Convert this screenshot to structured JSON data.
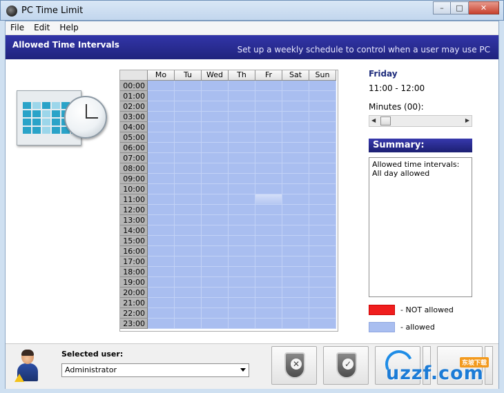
{
  "window": {
    "title": "PC Time Limit"
  },
  "menu": [
    "File",
    "Edit",
    "Help"
  ],
  "banner": {
    "title": "Allowed Time Intervals",
    "subtitle": "Set up a weekly schedule to control when a user may use PC"
  },
  "schedule": {
    "days": [
      "Mo",
      "Tu",
      "Wed",
      "Th",
      "Fr",
      "Sat",
      "Sun"
    ],
    "hours": [
      "00:00",
      "01:00",
      "02:00",
      "03:00",
      "04:00",
      "05:00",
      "06:00",
      "07:00",
      "08:00",
      "09:00",
      "10:00",
      "11:00",
      "12:00",
      "13:00",
      "14:00",
      "15:00",
      "16:00",
      "17:00",
      "18:00",
      "19:00",
      "20:00",
      "21:00",
      "22:00",
      "23:00"
    ],
    "selected_day": "Fr",
    "selected_hour": "11:00",
    "all_allowed": true
  },
  "details": {
    "day": "Friday",
    "time_range": "11:00 - 12:00",
    "minutes_label": "Minutes (00):"
  },
  "summary": {
    "title": "Summary:",
    "line1": "Allowed time intervals:",
    "line2": "All day allowed"
  },
  "legend": {
    "not_allowed": "- NOT allowed",
    "allowed": "- allowed",
    "not_allowed_color": "#f01e1e",
    "allowed_color": "#a9bef0"
  },
  "bottom": {
    "selected_user_label": "Selected user:",
    "selected_user": "Administrator",
    "watermark": "uzzf.com",
    "watermark_tag": "东坡下载"
  }
}
